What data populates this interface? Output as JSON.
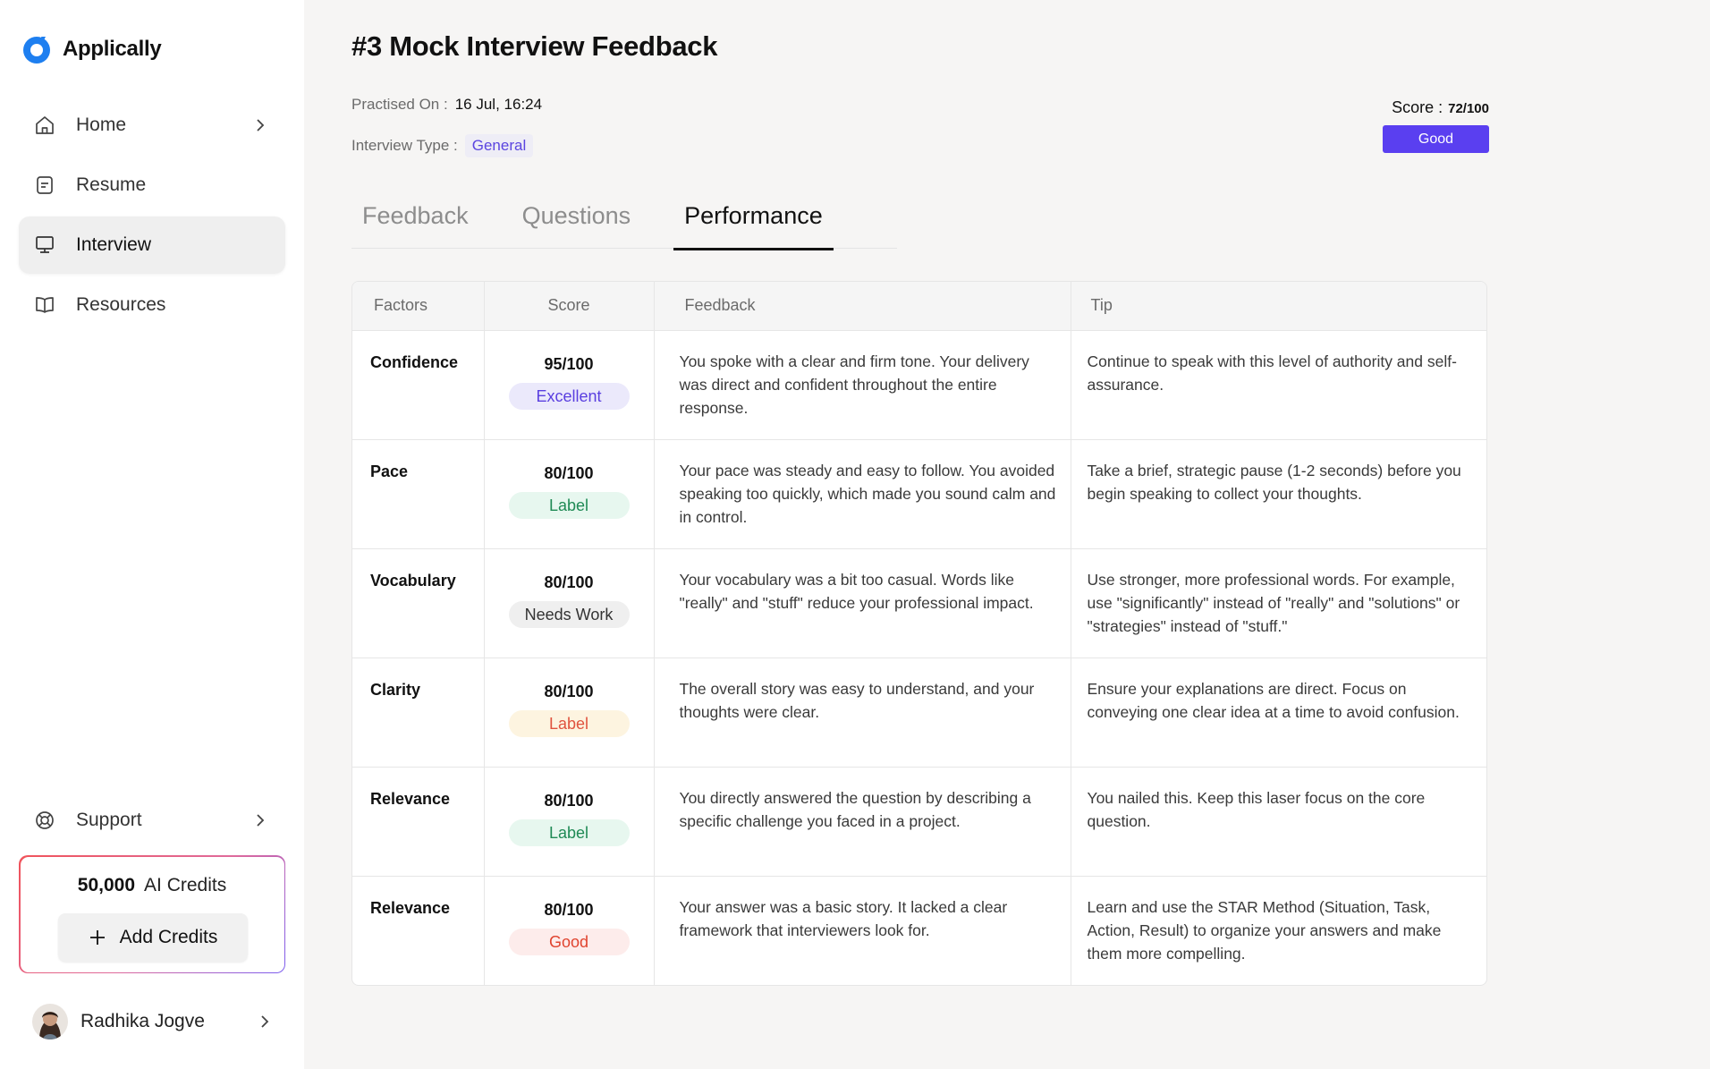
{
  "app": {
    "name": "Applically",
    "brand_color": "#1e7ff0",
    "accent": "#5a3ff0"
  },
  "sidebar": {
    "items": [
      {
        "label": "Home",
        "icon": "home-icon",
        "active": false,
        "has_chevron": true
      },
      {
        "label": "Resume",
        "icon": "document-icon",
        "active": false,
        "has_chevron": false
      },
      {
        "label": "Interview",
        "icon": "monitor-icon",
        "active": true,
        "has_chevron": false
      },
      {
        "label": "Resources",
        "icon": "book-icon",
        "active": false,
        "has_chevron": false
      }
    ],
    "support": {
      "label": "Support",
      "icon": "lifebuoy-icon"
    },
    "credits": {
      "amount": "50,000",
      "label": "AI Credits",
      "button_label": "Add Credits"
    },
    "user": {
      "name": "Radhika Jogve"
    }
  },
  "page": {
    "title": "#3 Mock Interview Feedback",
    "practised_label": "Practised On :",
    "practised_value": "16 Jul, 16:24",
    "type_label": "Interview Type :",
    "type_value": "General",
    "score_label": "Score :",
    "score_value": "72/100",
    "score_badge": "Good"
  },
  "tabs": [
    {
      "label": "Feedback",
      "active": false
    },
    {
      "label": "Questions",
      "active": false
    },
    {
      "label": "Performance",
      "active": true
    }
  ],
  "table": {
    "headers": [
      "Factors",
      "Score",
      "Feedback",
      "Tip"
    ],
    "rows": [
      {
        "factor": "Confidence",
        "score": "95/100",
        "label": "Excellent",
        "label_style": "purple",
        "feedback": "You spoke with a clear and firm tone. Your delivery was direct and confident throughout the entire response.",
        "tip": "Continue to speak with this level of authority and self-assurance."
      },
      {
        "factor": "Pace",
        "score": "80/100",
        "label": "Label",
        "label_style": "green",
        "feedback": "Your pace was steady and easy to follow. You avoided speaking too quickly, which made you sound calm and in control.",
        "tip": "Take a brief, strategic pause (1-2 seconds) before you begin speaking to collect your thoughts."
      },
      {
        "factor": "Vocabulary",
        "score": "80/100",
        "label": "Needs Work",
        "label_style": "gray",
        "feedback": "Your vocabulary was a bit too casual. Words like \"really\" and \"stuff\" reduce your professional impact.",
        "tip": "Use stronger, more professional words. For example, use \"significantly\" instead of \"really\" and \"solutions\" or \"strategies\" instead of \"stuff.\""
      },
      {
        "factor": "Clarity",
        "score": "80/100",
        "label": "Label",
        "label_style": "yellow",
        "feedback": "The overall story was easy to understand, and your thoughts were clear.",
        "tip": "Ensure your explanations are direct. Focus on conveying one clear idea at a time to avoid confusion."
      },
      {
        "factor": "Relevance",
        "score": "80/100",
        "label": "Label",
        "label_style": "green",
        "feedback": "You directly answered the question by describing a specific challenge you faced in a project.",
        "tip": "You nailed this. Keep this laser focus on the core question."
      },
      {
        "factor": "Relevance",
        "score": "80/100",
        "label": "Good",
        "label_style": "red",
        "feedback": "Your answer was a basic story. It lacked a clear framework that interviewers look for.",
        "tip": "Learn and use the STAR Method (Situation, Task, Action, Result) to organize your answers and make them more compelling."
      }
    ]
  }
}
